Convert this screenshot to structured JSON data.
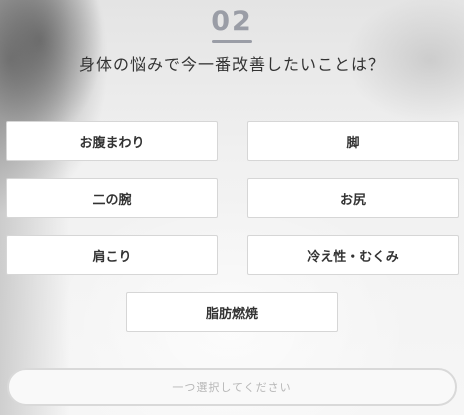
{
  "step": {
    "number": "02",
    "question": "身体の悩みで今一番改善したいことは？"
  },
  "options": [
    {
      "label": "お腹まわり"
    },
    {
      "label": "脚"
    },
    {
      "label": "二の腕"
    },
    {
      "label": "お尻"
    },
    {
      "label": "肩こり"
    },
    {
      "label": "冷え性・むくみ"
    },
    {
      "label": "脂肪燃焼"
    }
  ],
  "submit": {
    "label": "一つ選択してください",
    "enabled": false
  },
  "colors": {
    "step_number": "#9a9da6",
    "question_text": "#333333",
    "option_border": "#d6d6d6",
    "submit_text_disabled": "#b7b7b7"
  }
}
